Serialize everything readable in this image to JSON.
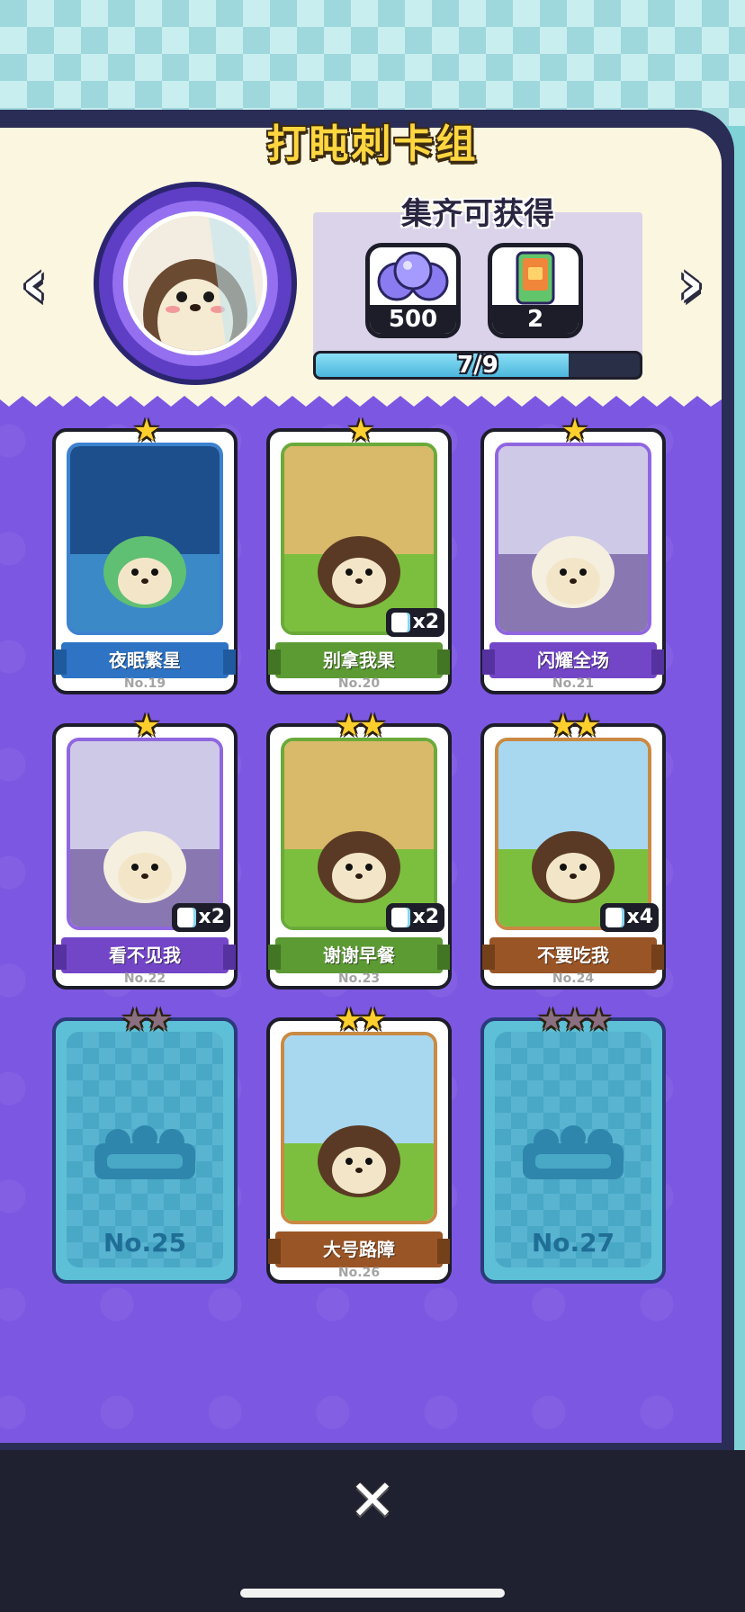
{
  "title": "打盹刺卡组",
  "nav": {
    "prev": "‹",
    "next": "›"
  },
  "rewards": {
    "heading": "集齐可获得",
    "items": [
      {
        "icon": "purple-coins-icon",
        "count": "500"
      },
      {
        "icon": "card-pack-icon",
        "count": "2"
      }
    ],
    "progress_text": "7/9",
    "progress_fraction": 0.78
  },
  "cards": [
    {
      "name": "夜眠繁星",
      "no": "No.19",
      "stars": 1,
      "max_stars": 1,
      "dup": "",
      "theme": "blue",
      "locked": false
    },
    {
      "name": "别拿我果",
      "no": "No.20",
      "stars": 1,
      "max_stars": 1,
      "dup": "x2",
      "theme": "green",
      "locked": false
    },
    {
      "name": "闪耀全场",
      "no": "No.21",
      "stars": 1,
      "max_stars": 1,
      "dup": "",
      "theme": "purple",
      "locked": false
    },
    {
      "name": "看不见我",
      "no": "No.22",
      "stars": 1,
      "max_stars": 1,
      "dup": "x2",
      "theme": "purple",
      "locked": false
    },
    {
      "name": "谢谢早餐",
      "no": "No.23",
      "stars": 2,
      "max_stars": 2,
      "dup": "x2",
      "theme": "green",
      "locked": false
    },
    {
      "name": "不要吃我",
      "no": "No.24",
      "stars": 2,
      "max_stars": 2,
      "dup": "x4",
      "theme": "brown",
      "locked": false
    },
    {
      "name": "",
      "no": "No.25",
      "stars": 0,
      "max_stars": 2,
      "dup": "",
      "theme": "locked",
      "locked": true
    },
    {
      "name": "大号路障",
      "no": "No.26",
      "stars": 2,
      "max_stars": 2,
      "dup": "",
      "theme": "brown",
      "locked": false
    },
    {
      "name": "",
      "no": "No.27",
      "stars": 0,
      "max_stars": 3,
      "dup": "",
      "theme": "locked",
      "locked": true
    }
  ],
  "close_label": "✕",
  "colors": {
    "accent": "#7c57e2",
    "title": "#ffd640",
    "blue": "#2e73c4",
    "green": "#5c9a34",
    "purple": "#7346c8",
    "brown": "#9a5526"
  }
}
